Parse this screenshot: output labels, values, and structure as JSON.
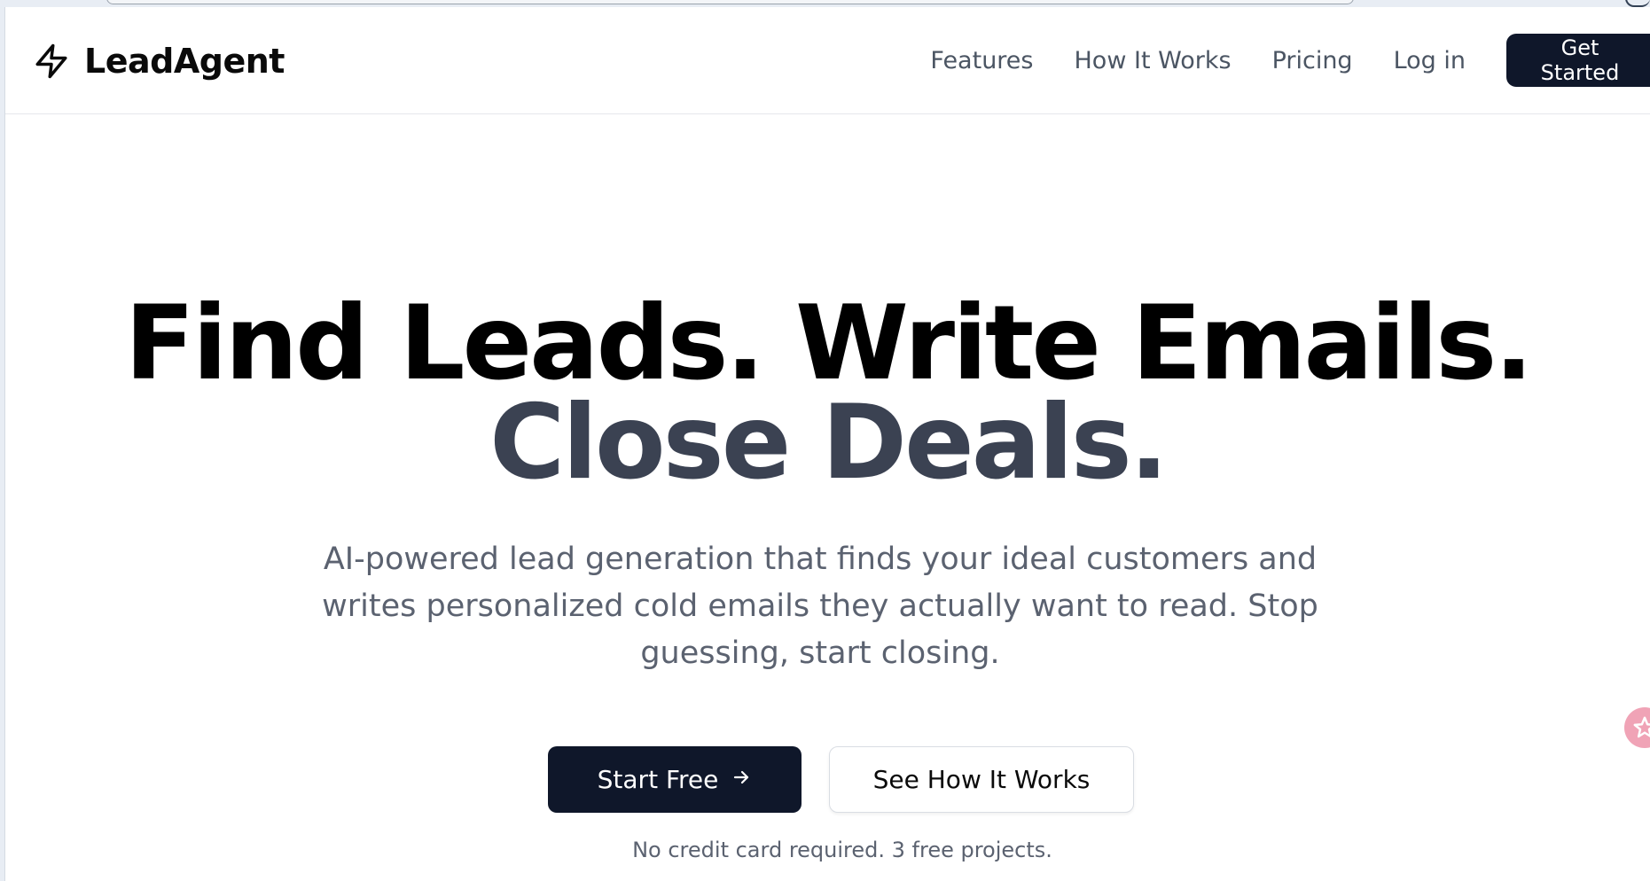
{
  "header": {
    "logo_icon": "lightning-bolt-icon",
    "logo_text": "LeadAgent",
    "nav": [
      {
        "label": "Features"
      },
      {
        "label": "How It Works"
      },
      {
        "label": "Pricing"
      },
      {
        "label": "Log in"
      }
    ],
    "cta_label": "Get Started"
  },
  "hero": {
    "title_part1": "Find Leads. Write Emails. ",
    "title_part2": "Close Deals.",
    "subtitle": "AI-powered lead generation that finds your ideal customers and writes personalized cold emails they actually want to read. Stop guessing, start closing.",
    "primary_cta": "Start Free",
    "primary_cta_icon": "arrow-right-icon",
    "secondary_cta": "See How It Works",
    "fineprint": "No credit card required. 3 free projects."
  },
  "floating_widget": {
    "icon": "assistant-badge-icon"
  },
  "colors": {
    "primary_dark": "#0f172a",
    "heading": "#000000",
    "heading_muted": "#3b4252",
    "body_text": "#5b6270",
    "nav_text": "#4b5563",
    "widget_pink": "#f0a3b6"
  }
}
